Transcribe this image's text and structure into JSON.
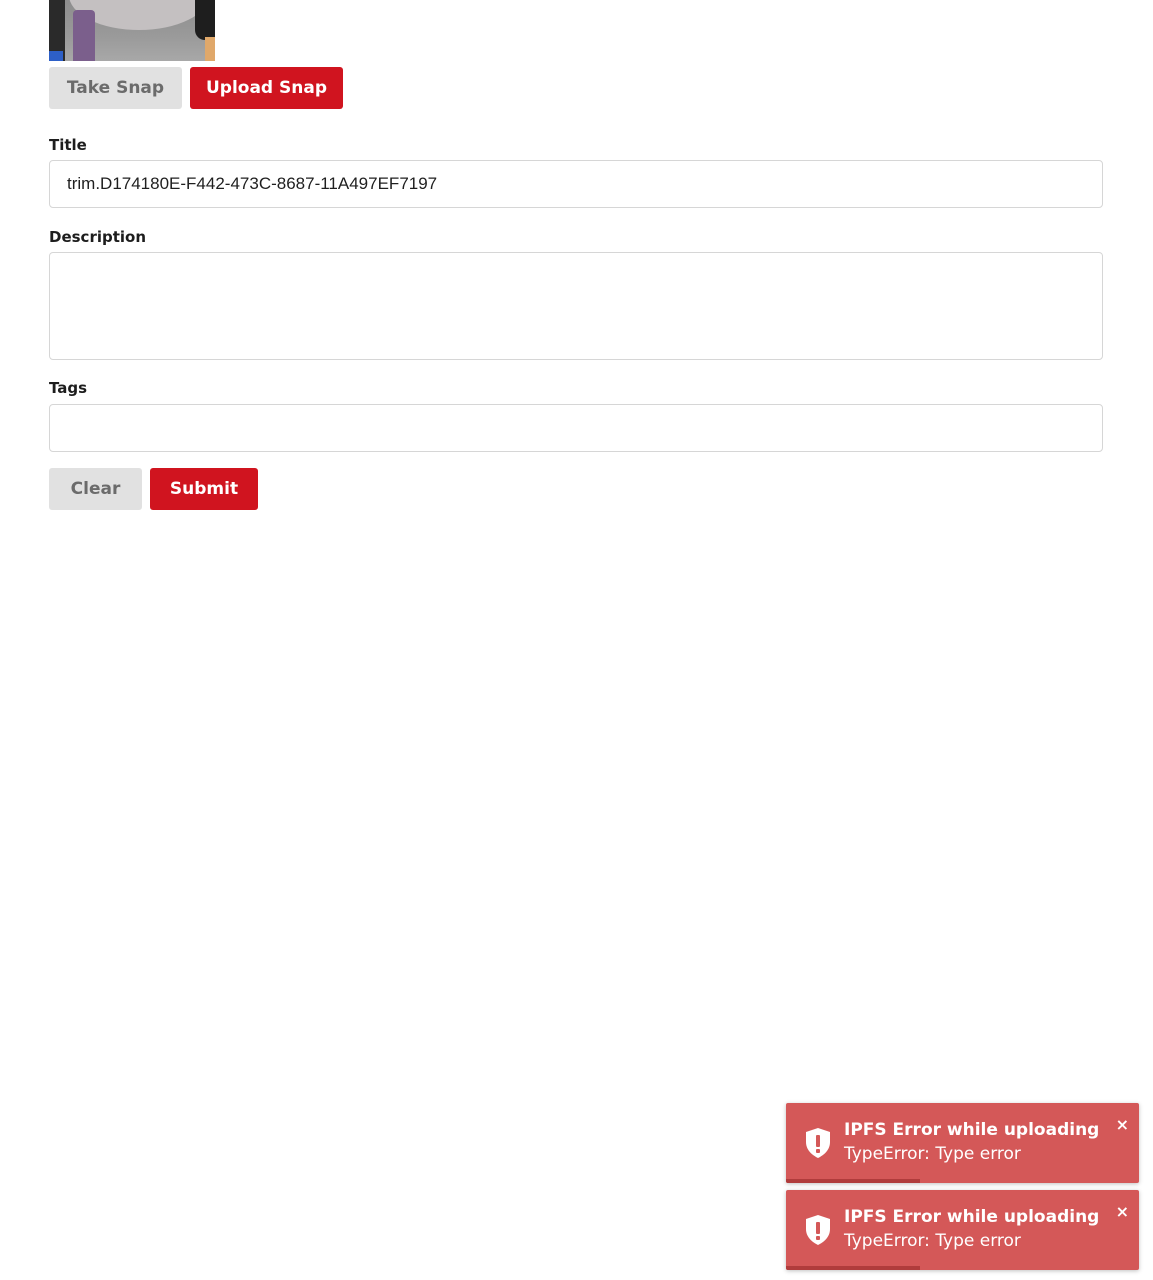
{
  "colors": {
    "accent_red": "#d0141f",
    "button_gray": "#e1e1e1",
    "toast_bg": "#d45858"
  },
  "snap": {
    "take_label": "Take Snap",
    "upload_label": "Upload Snap"
  },
  "form": {
    "title_label": "Title",
    "title_value": "trim.D174180E-F442-473C-8687-11A497EF7197",
    "description_label": "Description",
    "description_value": "",
    "tags_label": "Tags",
    "tags_value": "",
    "clear_label": "Clear",
    "submit_label": "Submit"
  },
  "toasts": [
    {
      "icon": "shield-exclamation-icon",
      "title": "IPFS Error while uploading",
      "message": "TypeError: Type error",
      "close": "×",
      "progress": 0.38
    },
    {
      "icon": "shield-exclamation-icon",
      "title": "IPFS Error while uploading",
      "message": "TypeError: Type error",
      "close": "×",
      "progress": 0.38
    }
  ]
}
